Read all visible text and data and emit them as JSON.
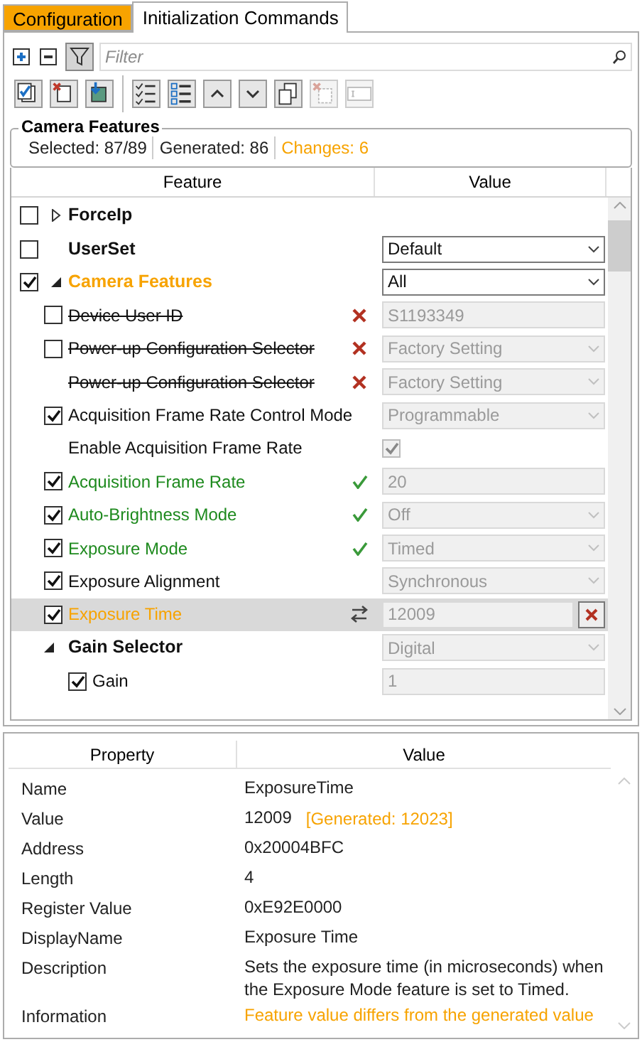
{
  "tabs": [
    {
      "label": "Configuration",
      "selected": false,
      "highlighted": true
    },
    {
      "label": "Initialization Commands",
      "selected": true,
      "highlighted": false
    }
  ],
  "filter_bar": {
    "placeholder": "Filter",
    "filter_on": true
  },
  "toolbar": [
    {
      "kind": "apply",
      "disabled": false
    },
    {
      "kind": "remove",
      "disabled": false
    },
    {
      "kind": "import",
      "disabled": false
    },
    {
      "kind": "checklist",
      "disabled": false
    },
    {
      "kind": "list",
      "disabled": false
    },
    {
      "kind": "up",
      "disabled": false
    },
    {
      "kind": "down",
      "disabled": false
    },
    {
      "kind": "copy",
      "disabled": false
    },
    {
      "kind": "delete",
      "disabled": true
    },
    {
      "kind": "field",
      "disabled": true
    }
  ],
  "group": {
    "title": "Camera Features",
    "selected": "Selected: 87/89",
    "generated": "Generated: 86",
    "changes": "Changes: 6"
  },
  "grid": {
    "columns": [
      "Feature",
      "Value"
    ],
    "rows": [
      {
        "label": "ForceIp",
        "kind": "category",
        "checked": false,
        "expanded": false,
        "selected": false,
        "removed": false,
        "matched": false,
        "changed": false
      },
      {
        "label": "UserSet",
        "kind": "category",
        "checked": false,
        "selected": false,
        "removed": false,
        "matched": false,
        "changed": false,
        "value": {
          "kind": "dropdown",
          "text": "Default",
          "enabled": true
        }
      },
      {
        "label": "Camera Features",
        "kind": "category",
        "checked": true,
        "expanded": true,
        "selected": false,
        "removed": false,
        "matched": false,
        "changed": true,
        "value": {
          "kind": "dropdown",
          "text": "All",
          "enabled": true
        },
        "children": [
          {
            "label": "Device User ID",
            "kind": "feature",
            "checked": false,
            "selected": false,
            "removed": true,
            "matched": false,
            "changed": false,
            "value": {
              "kind": "text",
              "text": "S1193349",
              "enabled": false
            }
          },
          {
            "label": "Power-up Configuration Selector",
            "kind": "feature",
            "checked": false,
            "selected": false,
            "removed": true,
            "matched": false,
            "changed": false,
            "value": {
              "kind": "dropdown",
              "text": "Factory Setting",
              "enabled": false
            }
          },
          {
            "label": "Power-up Configuration Selector",
            "kind": "feature",
            "selected": false,
            "removed": true,
            "matched": false,
            "changed": false,
            "value": {
              "kind": "dropdown",
              "text": "Factory Setting",
              "enabled": false
            }
          },
          {
            "label": "Acquisition Frame Rate Control Mode",
            "kind": "feature",
            "checked": true,
            "selected": false,
            "removed": false,
            "matched": false,
            "changed": false,
            "value": {
              "kind": "dropdown",
              "text": "Programmable",
              "enabled": false
            }
          },
          {
            "label": "Enable Acquisition Frame Rate",
            "kind": "feature",
            "selected": false,
            "removed": false,
            "matched": false,
            "changed": false,
            "value": {
              "kind": "checkbox",
              "checked": true
            }
          },
          {
            "label": "Acquisition Frame Rate",
            "kind": "feature",
            "checked": true,
            "selected": false,
            "removed": false,
            "matched": true,
            "changed": false,
            "value": {
              "kind": "text",
              "text": "20",
              "enabled": false
            }
          },
          {
            "label": "Auto-Brightness Mode",
            "kind": "feature",
            "checked": true,
            "selected": false,
            "removed": false,
            "matched": true,
            "changed": false,
            "value": {
              "kind": "dropdown",
              "text": "Off",
              "enabled": false
            }
          },
          {
            "label": "Exposure Mode",
            "kind": "feature",
            "checked": true,
            "selected": false,
            "removed": false,
            "matched": true,
            "changed": false,
            "value": {
              "kind": "dropdown",
              "text": "Timed",
              "enabled": false
            }
          },
          {
            "label": "Exposure Alignment",
            "kind": "feature",
            "checked": true,
            "selected": false,
            "removed": false,
            "matched": false,
            "changed": false,
            "value": {
              "kind": "dropdown",
              "text": "Synchronous",
              "enabled": false
            }
          },
          {
            "label": "Exposure Time",
            "kind": "feature",
            "checked": true,
            "selected": true,
            "removed": false,
            "matched": false,
            "changed": true,
            "value": {
              "kind": "text",
              "text": "12009",
              "enabled": false,
              "clearable": true
            }
          },
          {
            "label": "Gain Selector",
            "kind": "category",
            "expanded": true,
            "selected": false,
            "removed": false,
            "matched": false,
            "changed": false,
            "value": {
              "kind": "dropdown",
              "text": "Digital",
              "enabled": false
            },
            "children": [
              {
                "label": "Gain",
                "kind": "feature",
                "checked": true,
                "selected": false,
                "removed": false,
                "matched": false,
                "changed": false,
                "value": {
                  "kind": "text",
                  "text": "1",
                  "enabled": false
                }
              }
            ]
          }
        ]
      }
    ]
  },
  "properties": {
    "columns": [
      "Property",
      "Value"
    ],
    "rows": [
      {
        "name": "Name",
        "value": "ExposureTime",
        "highlight": false
      },
      {
        "name": "Value",
        "value": "12009",
        "note": "[Generated: 12023]",
        "highlight": false
      },
      {
        "name": "Address",
        "value": "0x20004BFC",
        "highlight": false
      },
      {
        "name": "Length",
        "value": "4",
        "highlight": false
      },
      {
        "name": "Register Value",
        "value": "0xE92E0000",
        "highlight": false
      },
      {
        "name": "DisplayName",
        "value": "Exposure Time",
        "highlight": false
      },
      {
        "name": "Description",
        "value": "Sets the exposure time (in microseconds) when the Exposure Mode feature is set to Timed.",
        "highlight": false
      },
      {
        "name": "Information",
        "value": "Feature value differs from the generated value",
        "highlight": true
      }
    ]
  }
}
